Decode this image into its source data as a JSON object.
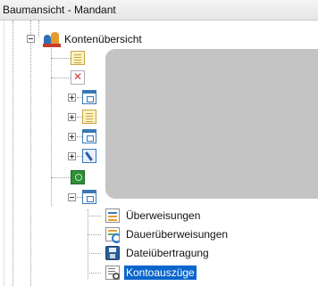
{
  "window": {
    "title": "Baumansicht - Mandant"
  },
  "tree": {
    "root": {
      "label": "Kontenübersicht",
      "icon": "account-group-icon",
      "expanded": true
    },
    "children": [
      {
        "icon": "document-icon",
        "expander": "none",
        "label": ""
      },
      {
        "icon": "chart-icon",
        "expander": "none",
        "label": ""
      },
      {
        "icon": "window-icon",
        "expander": "plus",
        "label": ""
      },
      {
        "icon": "document-icon",
        "expander": "plus",
        "label": ""
      },
      {
        "icon": "window-icon",
        "expander": "plus",
        "label": ""
      },
      {
        "icon": "tools-icon",
        "expander": "plus",
        "label": ""
      },
      {
        "icon": "money-icon",
        "expander": "none",
        "label": ""
      },
      {
        "icon": "window-icon",
        "expander": "minus",
        "label": "",
        "expanded": true
      }
    ],
    "subitems": [
      {
        "label": "Überweisungen",
        "icon": "transfer-form-icon"
      },
      {
        "label": "Dauerüberweisungen",
        "icon": "standing-order-icon"
      },
      {
        "label": "Dateiübertragung",
        "icon": "file-transfer-icon"
      },
      {
        "label": "Kontoauszüge",
        "icon": "account-statement-icon",
        "selected": true
      }
    ]
  },
  "colors": {
    "selection": "#0a66cc",
    "redacted_overlay": "#c4c4c4"
  }
}
